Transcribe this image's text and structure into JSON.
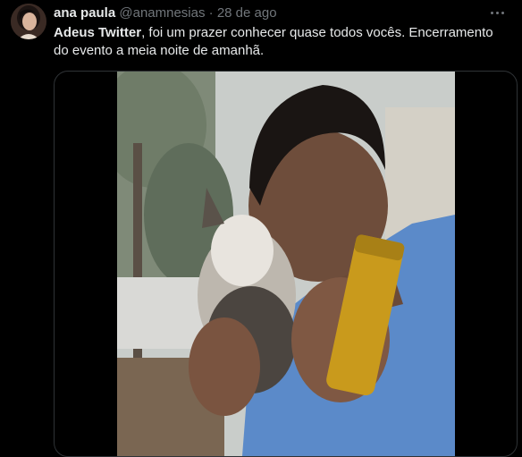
{
  "tweet": {
    "author_name": "ana paula",
    "handle": "@anamnesias",
    "separator": "·",
    "date": "28 de ago",
    "text_bold": "Adeus Twitter",
    "text_rest": ", foi um prazer conhecer quase todos vocês. Encerramento do evento a meia noite de amanhã."
  },
  "icons": {
    "more": "more-horizontal-icon",
    "avatar": "profile-photo"
  },
  "colors": {
    "background": "#000000",
    "text_primary": "#e7e9ea",
    "text_secondary": "#71767b",
    "border": "#2f3336"
  }
}
